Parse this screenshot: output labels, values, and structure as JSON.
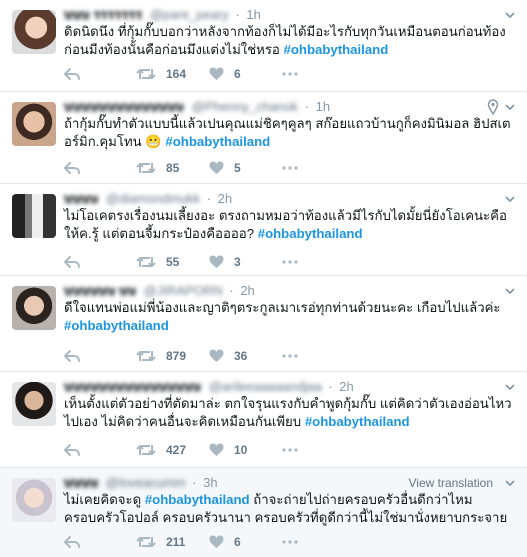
{
  "tweets": [
    {
      "name": "ษษษ รรรรรรร",
      "handle": "@pare_peary",
      "time": "1h",
      "text": "ดิดนิดนึง ที่กุ้มกั๊บบอกว่าหลังจากท้องก็ไม่ได้มีอะไรกับทุกวันเหมือนตอนก่อนท้อง ก่อนมีงท้องนั้นคือก่อนมึงแต่งไม่ใช่หรอ ",
      "hashtag": "#ohbabythailand",
      "text_after": "",
      "retweets": "164",
      "likes": "6",
      "has_pin": false,
      "translate": ""
    },
    {
      "name": "ษษษษษษษษษษษษษษ",
      "handle": "@Phenny_chanok",
      "time": "1h",
      "text": "ถ้ากุ้มกั๊บทำตัวแบบนี้แล้วเปนคุณแม่ชิคๆคูลๆ สก๊อยแถวบ้านกูก็คงมินิมอล ฮิปสเตอร์มิก.คุมโทน 😬 ",
      "hashtag": "#ohbabythailand",
      "text_after": "",
      "retweets": "85",
      "likes": "5",
      "has_pin": true,
      "translate": ""
    },
    {
      "name": "ษษษษ",
      "handle": "@diamondmukk",
      "time": "2h",
      "text": "ไม่โอเคตรงเรื่องนมเลี้ยงอะ ตรงถามหมอว่าท้องแล้วมีไรกับไดมั้ยนี่ยังโอเคนะคือให้ค.รู้ แต่ตอนจี้มกระป๋องคืออออ? ",
      "hashtag": "#ohbabythailand",
      "text_after": "",
      "retweets": "55",
      "likes": "3",
      "has_pin": false,
      "translate": ""
    },
    {
      "name": "ษษษษษษ ษษ",
      "handle": "@JIRAPORN",
      "time": "2h",
      "text": "ดีใจแทนพ่อแม่พี่น้องและญาติๆตระกูลเมาเรอ่ทุกท่านด้วยนะคะ เกือบไปแล้วค่ะ ",
      "hashtag": "#ohbabythailand",
      "text_after": "",
      "retweets": "879",
      "likes": "36",
      "has_pin": false,
      "translate": ""
    },
    {
      "name": "ษษษษษษษษษษษษษษษษ",
      "handle": "@arileeaaaaandjaa",
      "time": "2h",
      "text": "เห็นตั้งแต่ตัวอย่างที่ตัดมาล่ะ ตกใจรุนแรงกับคำพูดกุ้มกั๊บ แต่คิดว่าตัวเองอ่อนไหวไปเอง ไม่คิดว่าคนอื่นจะคิดเหมือนกันเพียบ ",
      "hashtag": "#ohbabythailand",
      "text_after": "",
      "retweets": "427",
      "likes": "10",
      "has_pin": false,
      "translate": ""
    },
    {
      "name": "ษษษษ",
      "handle": "@loveacumm",
      "time": "3h",
      "text": "ไม่เคยคิดจะดู ",
      "hashtag": "#ohbabythailand",
      "text_after": " ถ้าจะถ่ายไปถ่ายครอบครัวอื่นดีกว่าไหม ครอบครัวโอปอล์ ครอบครัวนานา ครอบครัวที่ดูดีกว่านี้ไม่ใช่มานั่งหยาบกระจาย",
      "retweets": "211",
      "likes": "6",
      "has_pin": true,
      "translate": "View translation"
    }
  ],
  "colors": {
    "accent": "#1b95e0",
    "muted": "#657786",
    "border": "#e1e8ed"
  }
}
